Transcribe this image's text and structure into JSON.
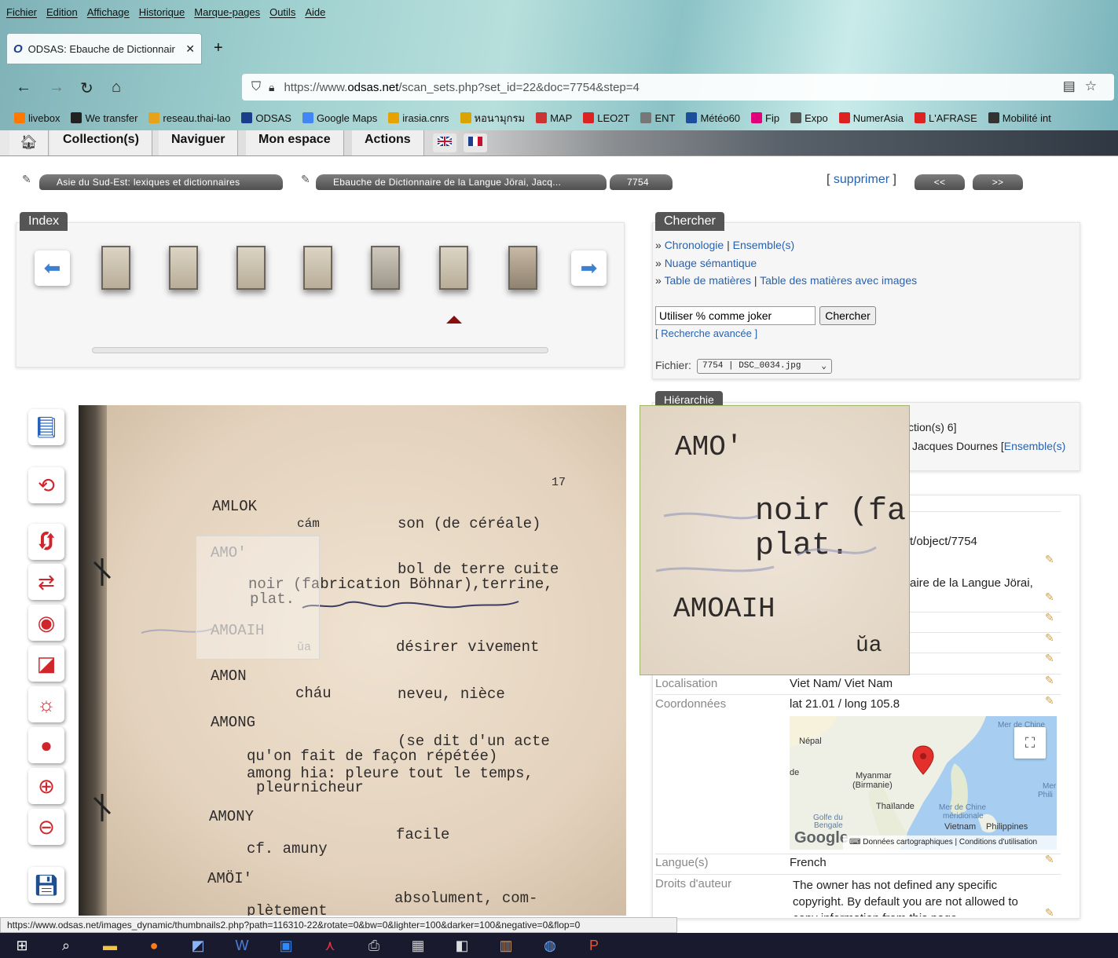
{
  "browser": {
    "menu": [
      "Fichier",
      "Edition",
      "Affichage",
      "Historique",
      "Marque-pages",
      "Outils",
      "Aide"
    ],
    "tab_title": "ODSAS: Ebauche de Dictionnair",
    "url_prefix": "https://www.",
    "url_host": "odsas.net",
    "url_path": "/scan_sets.php?set_id=22&doc=7754&step=4",
    "bookmarks": [
      {
        "label": "livebox",
        "icon": "livebox-icon",
        "color": "#ff7900"
      },
      {
        "label": "We transfer",
        "icon": "wetransfer-icon",
        "color": "#222"
      },
      {
        "label": "reseau.thai-lao",
        "icon": "reseau-icon",
        "color": "#e7a21c"
      },
      {
        "label": "ODSAS",
        "icon": "odsas-icon",
        "color": "#1b3e8a"
      },
      {
        "label": "Google Maps",
        "icon": "google-icon",
        "color": "#4285f4"
      },
      {
        "label": "irasia.cnrs",
        "icon": "irasia-icon",
        "color": "#e8a200"
      },
      {
        "label": "หอนามุกรม",
        "icon": "library-icon",
        "color": "#d9a400"
      },
      {
        "label": "MAP",
        "icon": "map-icon",
        "color": "#c33"
      },
      {
        "label": "LEO2T",
        "icon": "leo-icon",
        "color": "#d22"
      },
      {
        "label": "ENT",
        "icon": "ent-icon",
        "color": "#777"
      },
      {
        "label": "Météo60",
        "icon": "meteo-icon",
        "color": "#1a4f9c"
      },
      {
        "label": "Fip",
        "icon": "fip-icon",
        "color": "#e2007a"
      },
      {
        "label": "Expo",
        "icon": "expo-icon",
        "color": "#555"
      },
      {
        "label": "NumerAsia",
        "icon": "numerasia-icon",
        "color": "#d22"
      },
      {
        "label": "L'AFRASE",
        "icon": "afrase-icon",
        "color": "#d22"
      },
      {
        "label": "Mobilité int",
        "icon": "globe-icon",
        "color": "#333"
      }
    ],
    "status_url": "https://www.odsas.net/images_dynamic/thumbnails2.php?path=116310-22&rotate=0&bw=0&lighter=100&darker=100&negative=0&flop=0"
  },
  "site_nav": {
    "tabs": [
      "Collection(s)",
      "Naviguer",
      "Mon espace",
      "Actions"
    ]
  },
  "breadcrumb": {
    "items": [
      "Asie du Sud-Est: lexiques et dictionnaires",
      "Ebauche de Dictionnaire de la Langue Jörai, Jacq...",
      "7754"
    ],
    "delete_open": "[",
    "delete_label": "supprimer",
    "delete_close": "]",
    "prev": "<<",
    "next": ">>"
  },
  "index": {
    "title": "Index"
  },
  "search": {
    "title": "Chercher",
    "chronologie": "Chronologie",
    "ensembles": "Ensemble(s)",
    "nuage": "Nuage sémantique",
    "table": "Table de matières",
    "table_images": "Table des matières avec images",
    "prefix": "»",
    "sep": "|",
    "input_value": "Utiliser % comme joker",
    "button": "Chercher",
    "advanced": "[ Recherche avancée ]",
    "file_label": "Fichier:",
    "file_value": "7754 | DSC_0034.jpg"
  },
  "hierarchy": {
    "title": "Hiérarchie",
    "line1": "ction(s) 6]",
    "line2_prefix": "Jacques Dournes [",
    "line2_link": "Ensemble(s)"
  },
  "metadata": {
    "url_fragment": "t/object/7754",
    "title_fragment": "aire de la Langue Jörai,",
    "localisation_label": "Localisation",
    "localisation_value": "Viet Nam/ Viet Nam",
    "coord_label": "Coordonnées",
    "coord_value": "lat 21.01 / long 105.8",
    "langue_label": "Langue(s)",
    "langue_value": "French",
    "droits_label": "Droits d'auteur",
    "droits_value": "The owner has not defined any specific copyright. By default you are not allowed to copy information from this page."
  },
  "map": {
    "labels": [
      "Népal",
      "de",
      "Myanmar",
      "(Birmanie)",
      "Thaïlande",
      "Mer de Chine",
      "méridionale",
      "Vietnam",
      "Philippines",
      "Golfe du",
      "Bengale",
      "Mer de Chine",
      "Mer",
      "Phili"
    ],
    "logo": "Google",
    "attribution": "Données cartographiques",
    "terms": "Conditions d'utilisation"
  },
  "scan_text": {
    "page": "17",
    "lines": [
      "AMLOK",
      "cám",
      "son (de céréale)",
      "AMO'",
      "bol de terre cuite",
      "noir (fabrication Böhnar),terrine,",
      "plat.",
      "AMOAIH",
      "ŭa",
      "désirer vivement",
      "AMON",
      "cháu",
      "neveu, nièce",
      "AMONG",
      "(se dit d'un acte",
      "qu'on fait de façon répétée)",
      "among hia: pleure tout le temps,",
      "pleurnicheur",
      "AMONY",
      "facile",
      "cf. amuny",
      "AMÖI'",
      "absolument, com-",
      "plètement"
    ]
  },
  "magnifier_text": [
    "AMO'",
    "noir (fa",
    "plat.",
    "AMOAIH",
    "ŭa"
  ],
  "colors": {
    "link": "#2762b0",
    "edit": "#e0a030",
    "panel_title": "#555555",
    "nav_dark": "#2f3842"
  }
}
